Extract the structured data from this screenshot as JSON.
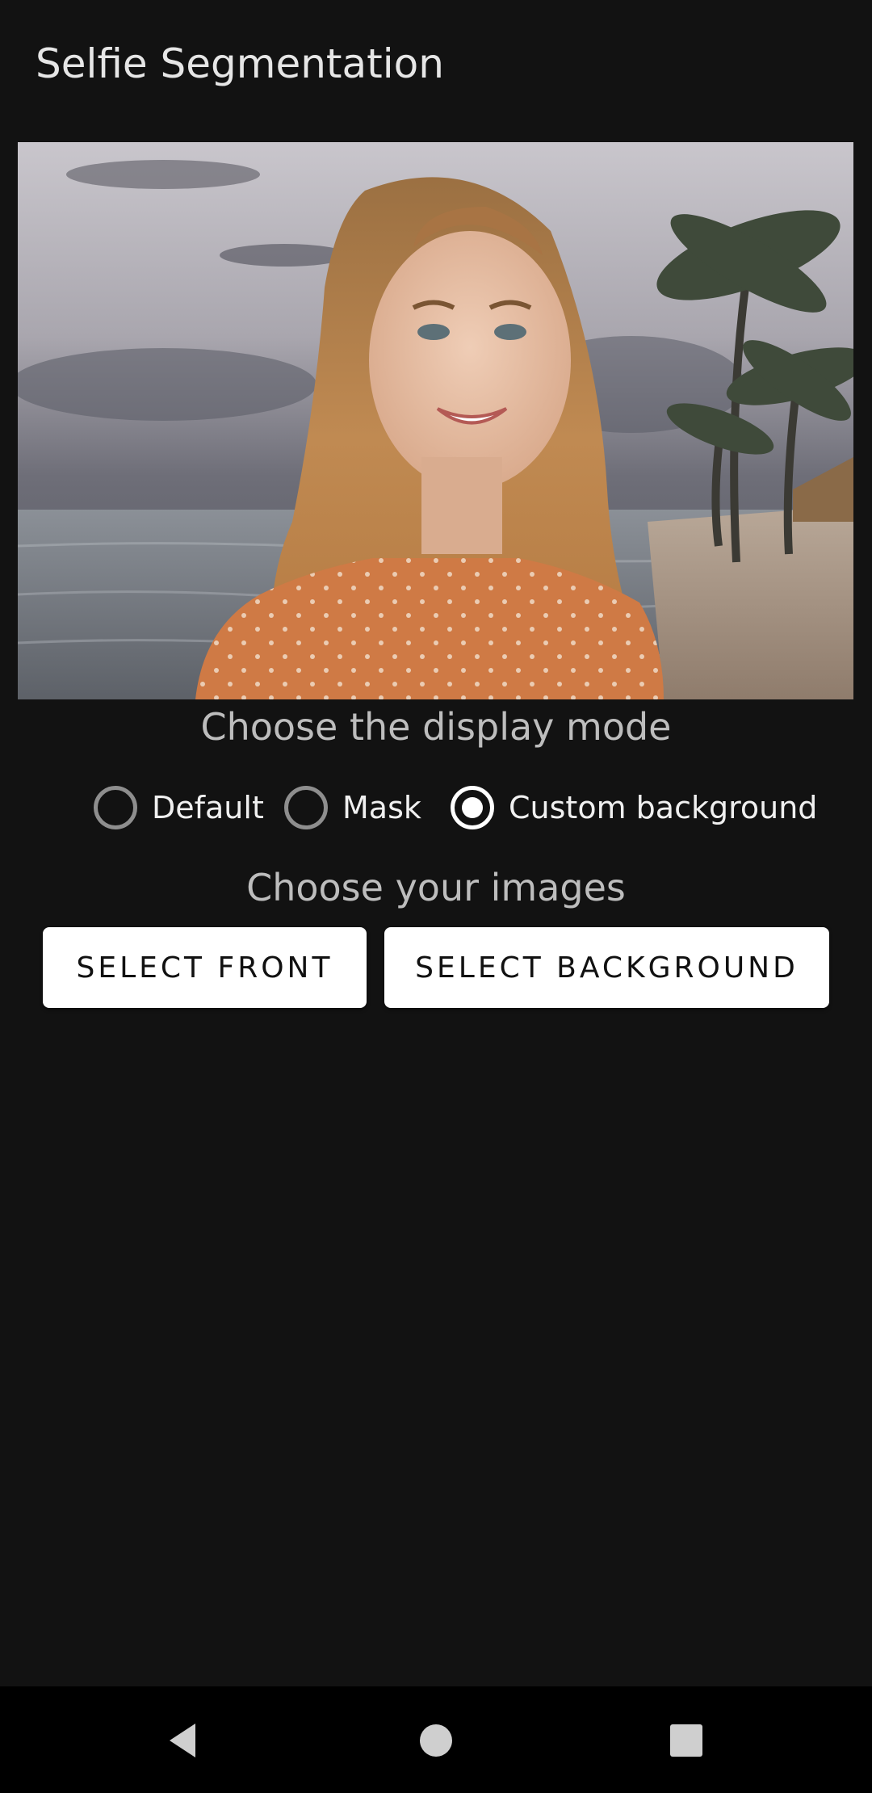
{
  "app_bar": {
    "title": "Selfie Segmentation"
  },
  "preview": {
    "image": "woman-portrait-on-tropical-beach-background"
  },
  "display_mode": {
    "label": "Choose the display mode",
    "options": [
      {
        "label": "Default",
        "checked": false
      },
      {
        "label": "Mask",
        "checked": false
      },
      {
        "label": "Custom background",
        "checked": true
      }
    ]
  },
  "images": {
    "label": "Choose your images",
    "select_front": "SELECT FRONT",
    "select_background": "SELECT BACKGROUND"
  },
  "nav": {
    "back_icon": "back-triangle-icon",
    "home_icon": "home-circle-icon",
    "recents_icon": "recents-square-icon"
  },
  "colors": {
    "background": "#121212",
    "button_bg": "#ffffff",
    "radio_checked": "#ffffff",
    "radio_unchecked": "#8e8e8e"
  }
}
